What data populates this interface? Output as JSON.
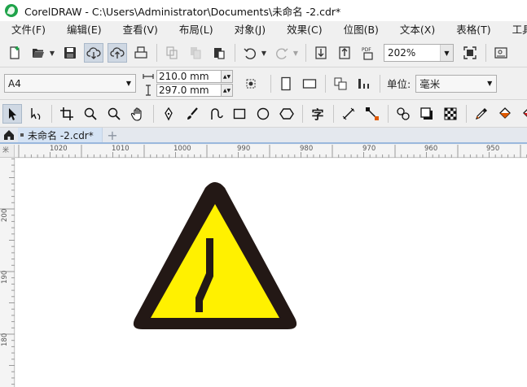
{
  "window": {
    "title": "CorelDRAW - C:\\Users\\Administrator\\Documents\\未命名 -2.cdr*"
  },
  "menu": [
    {
      "id": "file",
      "label": "文件(F)"
    },
    {
      "id": "edit",
      "label": "编辑(E)"
    },
    {
      "id": "view",
      "label": "查看(V)"
    },
    {
      "id": "layout",
      "label": "布局(L)"
    },
    {
      "id": "object",
      "label": "对象(J)"
    },
    {
      "id": "effects",
      "label": "效果(C)"
    },
    {
      "id": "bitmaps",
      "label": "位图(B)"
    },
    {
      "id": "text",
      "label": "文本(X)"
    },
    {
      "id": "table",
      "label": "表格(T)"
    },
    {
      "id": "tools",
      "label": "工具(O)"
    }
  ],
  "standard_toolbar": {
    "zoom_level": "202%",
    "pdf_label": "PDF"
  },
  "property_bar": {
    "page_size": "A4",
    "page_width": "210.0 mm",
    "page_height": "297.0 mm",
    "units_label": "单位:",
    "units_value": "毫米"
  },
  "toolbox": {
    "text_tool_glyph": "字"
  },
  "document_tab": {
    "label": "未命名 -2.cdr*",
    "add_label": "+"
  },
  "ruler": {
    "top_labels": [
      "1020",
      "1010",
      "1000",
      "990",
      "980",
      "970",
      "960",
      "950"
    ],
    "left_labels": [
      "200",
      "190",
      "180"
    ],
    "origin_mark": "米"
  },
  "colors": {
    "sign_border": "#231815",
    "sign_fill": "#fff100",
    "accent": "#1fa34a"
  }
}
